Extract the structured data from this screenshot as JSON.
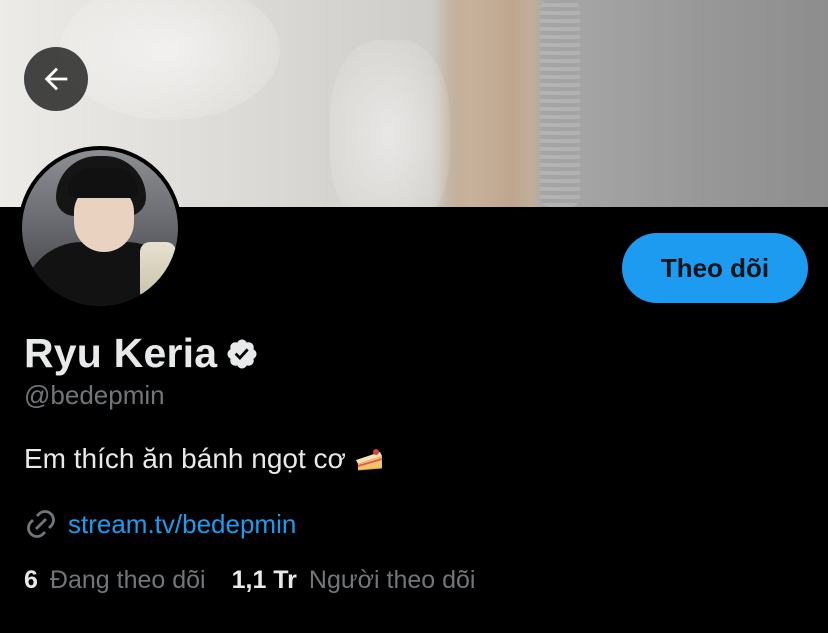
{
  "profile": {
    "name": "Ryu Keria",
    "handle": "@bedepmin",
    "verified": true,
    "bio": "Em thích ăn bánh ngọt cơ",
    "bio_emoji": "cake-slice-icon",
    "link": "stream.tv/bedepmin"
  },
  "actions": {
    "follow_label": "Theo dõi",
    "back_icon": "arrow-left-icon"
  },
  "stats": {
    "following_count": "6",
    "following_label": "Đang theo dõi",
    "followers_count": "1,1 Tr",
    "followers_label": "Người theo dõi"
  },
  "colors": {
    "background": "#000000",
    "accent": "#1d9bf0",
    "secondary_text": "#71767b",
    "primary_text": "#e7e9ea"
  }
}
